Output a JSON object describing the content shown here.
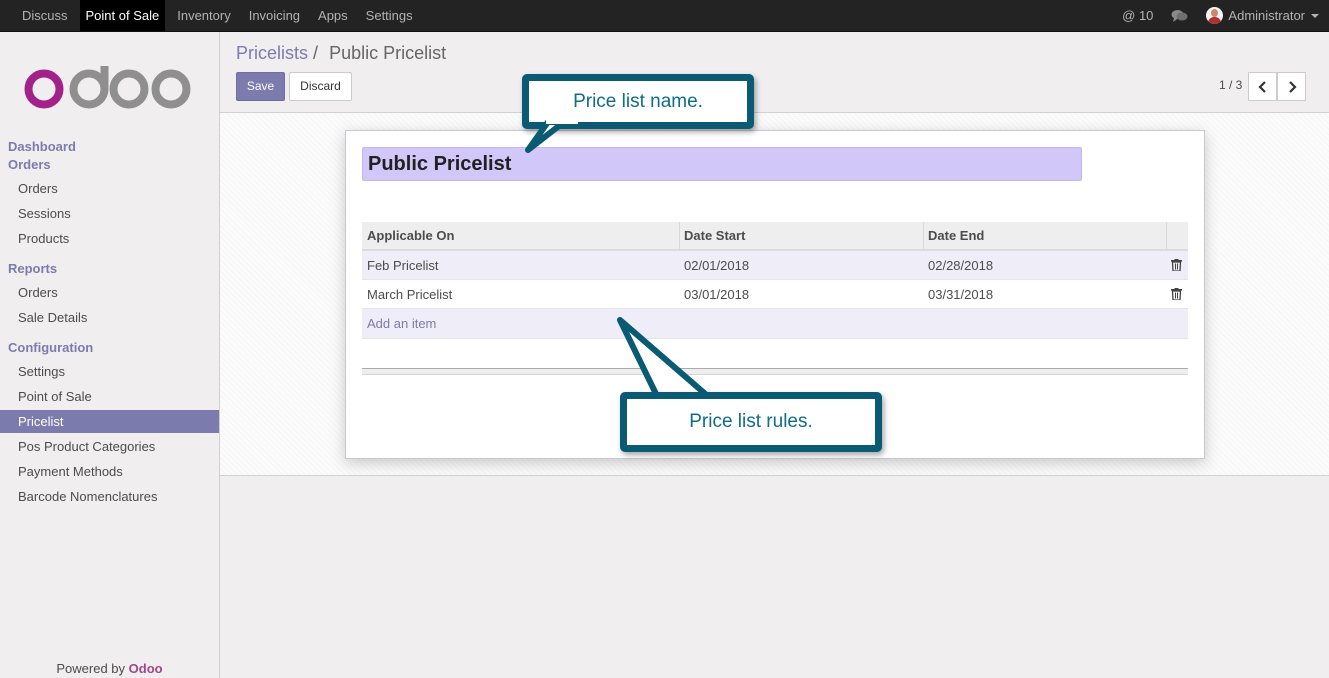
{
  "topbar": {
    "menu": [
      "Discuss",
      "Point of Sale",
      "Inventory",
      "Invoicing",
      "Apps",
      "Settings"
    ],
    "active_index": 1,
    "mentions": "@ 10",
    "user": "Administrator"
  },
  "sidebar": {
    "logo_text": "odoo",
    "sections": {
      "dashboard": "Dashboard",
      "orders": "Orders",
      "orders_items": [
        "Orders",
        "Sessions",
        "Products"
      ],
      "reports": "Reports",
      "reports_items": [
        "Orders",
        "Sale Details"
      ],
      "configuration": "Configuration",
      "configuration_items": [
        "Settings",
        "Point of Sale",
        "Pricelist",
        "Pos Product Categories",
        "Payment Methods",
        "Barcode Nomenclatures"
      ]
    },
    "selected": "Pricelist",
    "powered_by": "Powered by",
    "powered_brand": "Odoo"
  },
  "control_panel": {
    "breadcrumb_parent": "Pricelists",
    "breadcrumb_sep": "/",
    "breadcrumb_current": "Public Pricelist",
    "save_label": "Save",
    "discard_label": "Discard",
    "pager": "1 / 3"
  },
  "form": {
    "name_value": "Public Pricelist",
    "columns": [
      "Applicable On",
      "Date Start",
      "Date End"
    ],
    "rows": [
      {
        "applicable": "Feb Pricelist",
        "start": "02/01/2018",
        "end": "02/28/2018"
      },
      {
        "applicable": "March Pricelist",
        "start": "03/01/2018",
        "end": "03/31/2018"
      }
    ],
    "add_item": "Add an item"
  },
  "callouts": {
    "name": "Price list name.",
    "rules": "Price list rules."
  },
  "colors": {
    "accent": "#7c7bad",
    "callout_border": "#0b5a73",
    "name_field_bg": "#d1c7f8"
  }
}
